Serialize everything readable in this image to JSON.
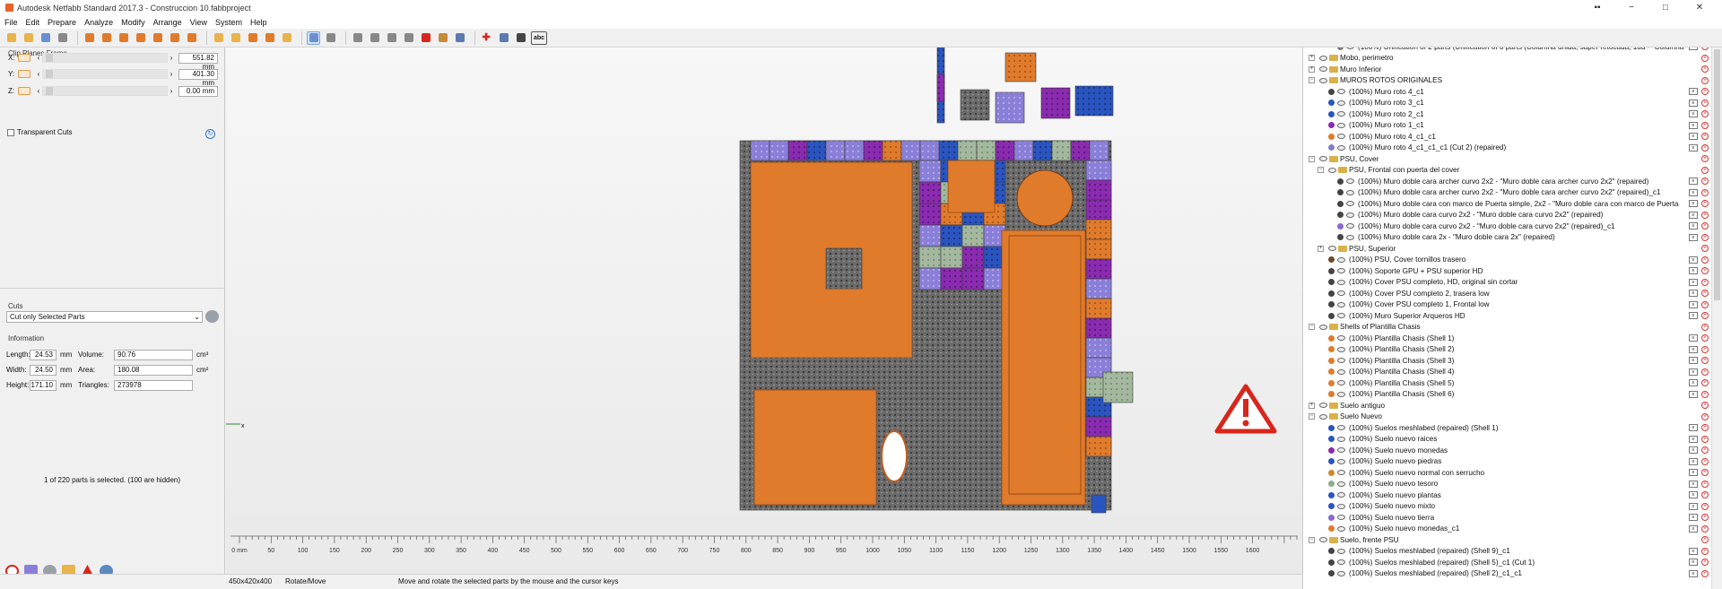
{
  "window": {
    "title": "Autodesk Netfabb Standard 2017.3 - Construccion 10.fabbproject",
    "controls": [
      "−",
      "□",
      "✕"
    ],
    "extra_icon": "▪▪"
  },
  "menu": [
    "File",
    "Edit",
    "Prepare",
    "Analyze",
    "Modify",
    "Arrange",
    "View",
    "System",
    "Help"
  ],
  "toolbar": {
    "icons": [
      "open-icon",
      "add-part-icon",
      "repair-icon",
      "measure-icon",
      "view-front-icon",
      "view-back-icon",
      "view-left-icon",
      "view-right-icon",
      "view-top-icon",
      "view-bottom-icon",
      "view-iso-icon",
      "pan-icon",
      "rotate-view-icon",
      "zoom-all-icon",
      "zoom-selection-icon",
      "search-icon",
      "pointer-icon",
      "move-icon",
      "slice-icon",
      "wire-icon",
      "shade-icon",
      "texture-icon",
      "color-icon",
      "material-icon",
      "flat-icon",
      "add-icon",
      "camera-icon",
      "label-icon"
    ],
    "label_button": "abc"
  },
  "clip_planes": {
    "title": "Clip Planes Frame",
    "axes": [
      {
        "axis": "X:",
        "value": "551.82 mm"
      },
      {
        "axis": "Y:",
        "value": "401.30 mm"
      },
      {
        "axis": "Z:",
        "value": "0.00 mm"
      }
    ],
    "transparent_label": "Transparent Cuts"
  },
  "cuts": {
    "title": "Cuts",
    "mode": "Cut only Selected Parts"
  },
  "information": {
    "title": "Information",
    "length_label": "Length:",
    "length": "24.53",
    "width_label": "Width:",
    "width": "24.50",
    "height_label": "Height:",
    "height": "171.10",
    "unit": "mm",
    "volume_label": "Volume:",
    "volume": "90.76",
    "volume_unit": "cm³",
    "area_label": "Area:",
    "area": "180.08",
    "area_unit": "cm²",
    "triangles_label": "Triangles:",
    "triangles": "273978"
  },
  "selection_status": "1 of 220 parts is selected. (100 are hidden)",
  "status": {
    "size": "450x420x400",
    "mode": "Rotate/Move",
    "hint": "Move and rotate the selected parts by the mouse and the cursor keys"
  },
  "ruler": {
    "labels": [
      "0 mm",
      "50",
      "100",
      "150",
      "200",
      "250",
      "300",
      "350",
      "400",
      "450",
      "500",
      "550",
      "600",
      "650",
      "700",
      "750",
      "800",
      "850",
      "900",
      "950",
      "1000",
      "1050",
      "1100",
      "1150",
      "1200",
      "1250",
      "1300",
      "1350",
      "1400",
      "1450",
      "1500",
      "1550",
      "1600"
    ]
  },
  "axes_gizmo": {
    "x": "x",
    "y": "y"
  },
  "tree": [
    {
      "lvl": 2,
      "type": "part",
      "color": "#7a7a7a",
      "label": "(100%) Unification of 2 parts (Unification of 3 parts (Columna unida, super retocada, 1ud - \"Columna"
    },
    {
      "lvl": 0,
      "type": "group",
      "exp": "+",
      "label": "Mobo, perimetro"
    },
    {
      "lvl": 0,
      "type": "group",
      "exp": "+",
      "label": "Muro Inferior"
    },
    {
      "lvl": 0,
      "type": "group",
      "exp": "−",
      "label": "MUROS ROTOS ORIGINALES"
    },
    {
      "lvl": 1,
      "type": "part",
      "color": "#444444",
      "label": "(100%) Muro roto 4_c1"
    },
    {
      "lvl": 1,
      "type": "part",
      "color": "#2a55c0",
      "label": "(100%) Muro roto 3_c1"
    },
    {
      "lvl": 1,
      "type": "part",
      "color": "#2a55c0",
      "label": "(100%) Muro roto 2_c1"
    },
    {
      "lvl": 1,
      "type": "part",
      "color": "#8a2bb0",
      "label": "(100%) Muro roto 1_c1"
    },
    {
      "lvl": 1,
      "type": "part",
      "color": "#e07b2c",
      "label": "(100%) Muro roto 4_c1_c1"
    },
    {
      "lvl": 1,
      "type": "part",
      "color": "#7e7ec8",
      "label": "(100%) Muro roto 4_c1_c1_c1 (Cut 2) (repaired)"
    },
    {
      "lvl": 0,
      "type": "group",
      "exp": "−",
      "label": "PSU, Cover"
    },
    {
      "lvl": 1,
      "type": "group",
      "exp": "−",
      "label": "PSU, Frontal con puerta del cover"
    },
    {
      "lvl": 2,
      "type": "part",
      "color": "#444444",
      "label": "(100%) Muro doble cara archer curvo 2x2 - \"Muro doble cara archer curvo 2x2\" (repaired)"
    },
    {
      "lvl": 2,
      "type": "part",
      "color": "#444444",
      "label": "(100%) Muro doble cara archer curvo 2x2 - \"Muro doble cara archer curvo 2x2\" (repaired)_c1"
    },
    {
      "lvl": 2,
      "type": "part",
      "color": "#444444",
      "label": "(100%) Muro doble cara con marco de Puerta simple, 2x2 - \"Muro doble cara con marco de Puerta"
    },
    {
      "lvl": 2,
      "type": "part",
      "color": "#444444",
      "label": "(100%) Muro doble cara curvo 2x2 - \"Muro doble cara curvo 2x2\" (repaired)"
    },
    {
      "lvl": 2,
      "type": "part",
      "color": "#8a6ad0",
      "label": "(100%) Muro doble cara curvo 2x2 - \"Muro doble cara curvo 2x2\" (repaired)_c1"
    },
    {
      "lvl": 2,
      "type": "part",
      "color": "#444444",
      "label": "(100%) Muro doble cara 2x - \"Muro doble cara 2x\" (repaired)"
    },
    {
      "lvl": 1,
      "type": "group",
      "exp": "+",
      "label": "PSU, Superior"
    },
    {
      "lvl": 1,
      "type": "part",
      "color": "#6b4a2a",
      "label": "(100%) PSU, Cover tornillos trasero"
    },
    {
      "lvl": 1,
      "type": "part",
      "color": "#444444",
      "label": "(100%) Soporte GPU + PSU superior HD"
    },
    {
      "lvl": 1,
      "type": "part",
      "color": "#444444",
      "label": "(100%) Cover PSU completo, HD, original sin cortar"
    },
    {
      "lvl": 1,
      "type": "part",
      "color": "#444444",
      "label": "(100%) Cover PSU completo 2, trasera low"
    },
    {
      "lvl": 1,
      "type": "part",
      "color": "#444444",
      "label": "(100%) Cover PSU completo 1, Frontal low"
    },
    {
      "lvl": 1,
      "type": "part",
      "color": "#444444",
      "label": "(100%) Muro Superior Arqueros HD"
    },
    {
      "lvl": 0,
      "type": "group",
      "exp": "−",
      "label": "Shells of Plantilla Chasis"
    },
    {
      "lvl": 1,
      "type": "part",
      "color": "#e07b2c",
      "label": "(100%) Plantilla Chasis (Shell 1)"
    },
    {
      "lvl": 1,
      "type": "part",
      "color": "#e07b2c",
      "label": "(100%) Plantilla Chasis (Shell 2)"
    },
    {
      "lvl": 1,
      "type": "part",
      "color": "#e07b2c",
      "label": "(100%) Plantilla Chasis (Shell 3)"
    },
    {
      "lvl": 1,
      "type": "part",
      "color": "#e07b2c",
      "label": "(100%) Plantilla Chasis (Shell 4)"
    },
    {
      "lvl": 1,
      "type": "part",
      "color": "#e07b2c",
      "label": "(100%) Plantilla Chasis (Shell 5)"
    },
    {
      "lvl": 1,
      "type": "part",
      "color": "#e07b2c",
      "label": "(100%) Plantilla Chasis (Shell 6)"
    },
    {
      "lvl": 0,
      "type": "group",
      "exp": "+",
      "label": "Suelo antiguo"
    },
    {
      "lvl": 0,
      "type": "group",
      "exp": "−",
      "label": "Suelo Nuevo"
    },
    {
      "lvl": 1,
      "type": "part",
      "color": "#2a55c0",
      "label": "(100%) Suelos meshlabed (repaired) (Shell 1)"
    },
    {
      "lvl": 1,
      "type": "part",
      "color": "#2a55c0",
      "label": "(100%) Suelo nuevo raices"
    },
    {
      "lvl": 1,
      "type": "part",
      "color": "#8a2bb0",
      "label": "(100%) Suelo nuevo monedas"
    },
    {
      "lvl": 1,
      "type": "part",
      "color": "#2a55c0",
      "label": "(100%) Suelo nuevo piedras"
    },
    {
      "lvl": 1,
      "type": "part",
      "color": "#d08a2c",
      "label": "(100%) Suelo nuevo normal con serrucho"
    },
    {
      "lvl": 1,
      "type": "part",
      "color": "#8fae8f",
      "label": "(100%) Suelo nuevo tesoro"
    },
    {
      "lvl": 1,
      "type": "part",
      "color": "#2a55c0",
      "label": "(100%) Suelo nuevo plantas"
    },
    {
      "lvl": 1,
      "type": "part",
      "color": "#2a55c0",
      "label": "(100%) Suelo nuevo mixto"
    },
    {
      "lvl": 1,
      "type": "part",
      "color": "#8a6ad0",
      "label": "(100%) Suelo nuevo tierra"
    },
    {
      "lvl": 1,
      "type": "part",
      "color": "#e07b2c",
      "label": "(100%) Suelo nuevo monedas_c1"
    },
    {
      "lvl": 0,
      "type": "group",
      "exp": "−",
      "label": "Suelo, frente PSU"
    },
    {
      "lvl": 1,
      "type": "part",
      "color": "#444444",
      "label": "(100%) Suelos meshlabed (repaired) (Shell 9)_c1"
    },
    {
      "lvl": 1,
      "type": "part",
      "color": "#444444",
      "label": "(100%) Suelos meshlabed (repaired) (Shell 5)_c1 (Cut 1)"
    },
    {
      "lvl": 1,
      "type": "part",
      "color": "#444444",
      "label": "(100%) Suelos meshlabed (repaired) (Shell 2)_c1_c1"
    }
  ],
  "colors": {
    "accent": "#e07b2c",
    "warning": "#d8261c",
    "purple": "#8a2bb0",
    "blue": "#2a55c0",
    "gray": "#555555",
    "lavender": "#8a7fd8",
    "sage": "#9fb59a"
  }
}
